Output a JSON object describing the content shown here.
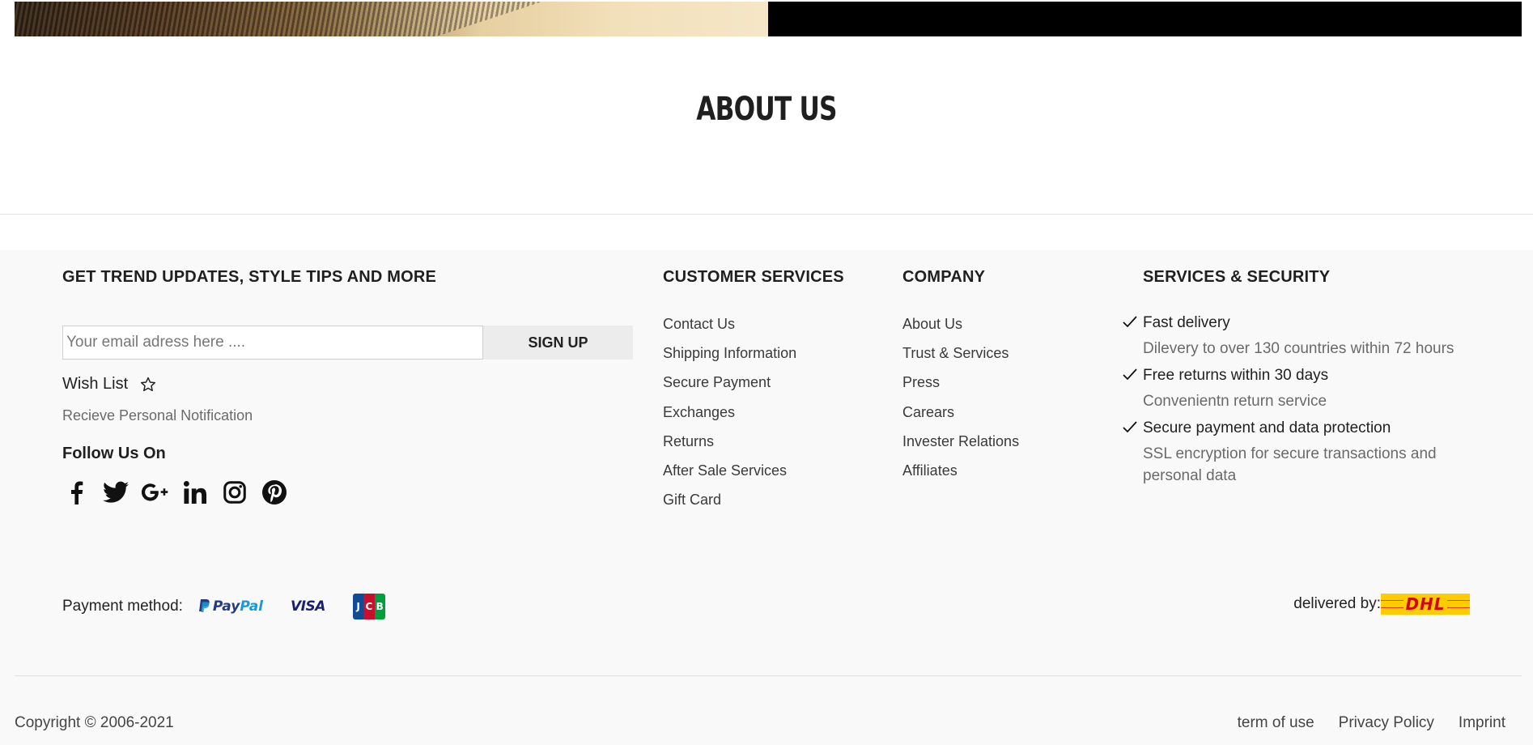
{
  "about": {
    "title": "ABOUT US"
  },
  "newsletter": {
    "title": "GET TREND UPDATES, STYLE TIPS AND MORE",
    "email_placeholder": "Your email adress here ....",
    "signup_label": "SIGN UP"
  },
  "wishlist": {
    "label": "Wish List",
    "icon": "star-outline-icon",
    "note": "Recieve Personal Notification"
  },
  "social": {
    "title": "Follow Us On",
    "icons": [
      "facebook-icon",
      "twitter-icon",
      "google-plus-icon",
      "linkedin-icon",
      "instagram-icon",
      "pinterest-icon"
    ]
  },
  "customer_services": {
    "title": "CUSTOMER SERVICES",
    "links": [
      "Contact Us",
      "Shipping Information",
      "Secure Payment",
      "Exchanges",
      "Returns",
      "After Sale Services",
      "Gift Card"
    ]
  },
  "company": {
    "title": "COMPANY",
    "links": [
      "About Us",
      "Trust & Services",
      "Press",
      "Carears",
      "Invester Relations",
      "Affiliates"
    ]
  },
  "services_security": {
    "title": "SERVICES & SECURITY",
    "items": [
      {
        "head": "Fast delivery",
        "desc": "Dilevery to over 130 countries within 72 hours"
      },
      {
        "head": "Free returns within 30 days",
        "desc": "Convenientn return service"
      },
      {
        "head": "Secure payment and data protection",
        "desc": "SSL encryption for secure transactions and personal data"
      }
    ]
  },
  "payment": {
    "label": "Payment method:",
    "methods": {
      "paypal_a": "Pay",
      "paypal_b": "Pal",
      "visa": "VISA",
      "jcb": [
        "J",
        "C",
        "B"
      ]
    }
  },
  "delivery": {
    "label": "delivered by:",
    "carrier": "DHL"
  },
  "bottom": {
    "copyright": "Copyright © 2006-2021",
    "links": [
      "term of use",
      "Privacy Policy",
      "Imprint"
    ]
  },
  "colors": {
    "footer_bg": "#f9f9f9",
    "paypal_dark": "#253b80",
    "paypal_light": "#179bd7",
    "visa": "#1a1f71",
    "dhl_yellow": "#ffcc00",
    "dhl_red": "#d40511"
  }
}
